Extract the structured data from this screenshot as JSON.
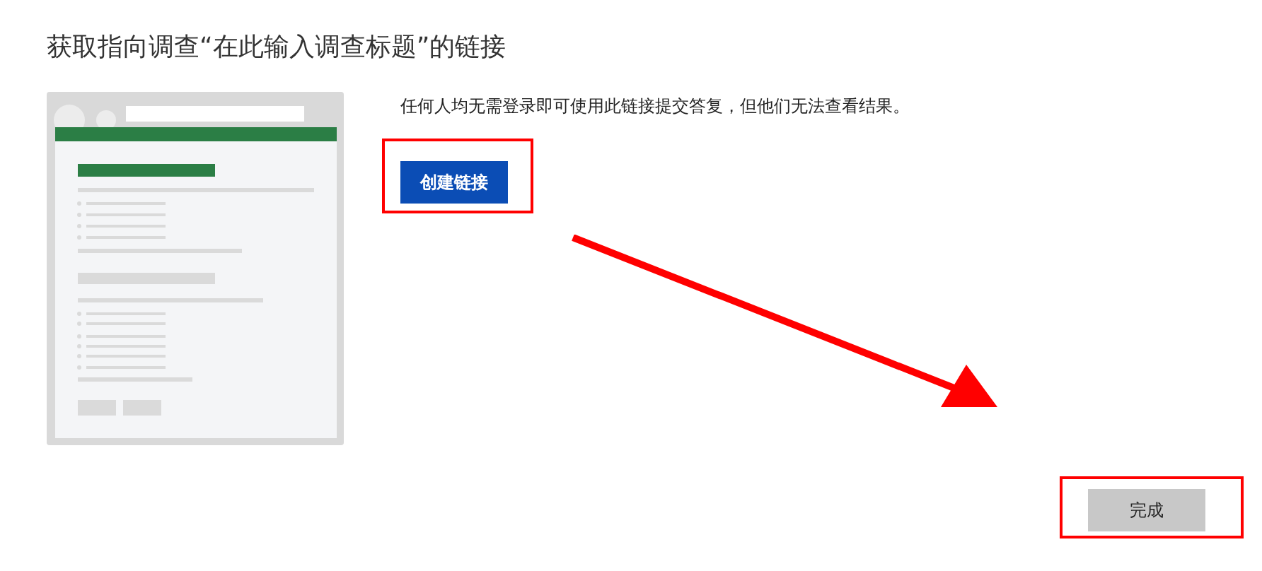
{
  "title": "获取指向调查“在此输入调查标题”的链接",
  "description": "任何人均无需登录即可使用此链接提交答复，但他们无法查看结果。",
  "create_button": {
    "label": "创建链接"
  },
  "done_button": {
    "label": "完成"
  }
}
